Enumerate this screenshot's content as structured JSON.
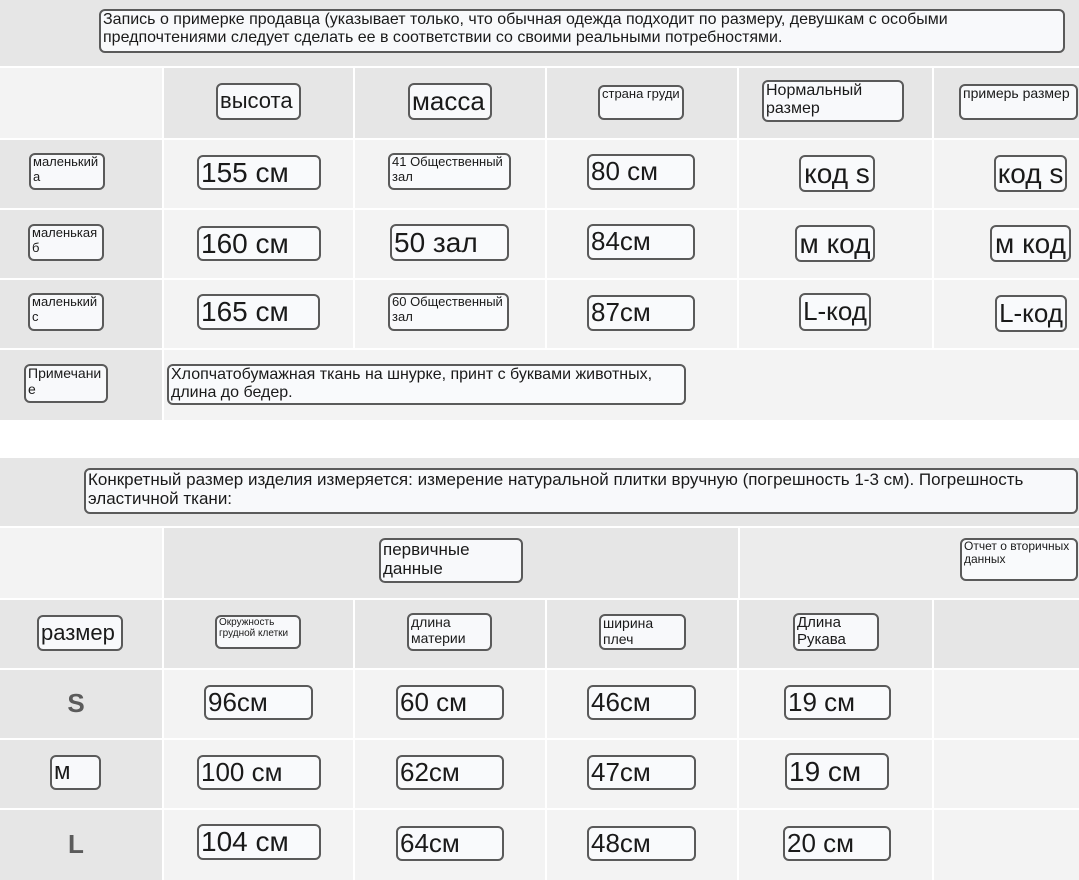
{
  "fitting": {
    "title": "Запись о примерке продавца (указывает только, что обычная одежда подходит по размеру, девушкам с особыми предпочтениями следует сделать ее в соответствии со своими реальными потребностями.",
    "headers": [
      "высота",
      "масса",
      "страна груди",
      "Нормальный размер",
      "примерь размер"
    ],
    "rows": [
      {
        "label": "маленький а",
        "height": "155 см",
        "weight": "41 Общественный зал",
        "chest": "80 см",
        "normal": "код s",
        "try": "код s"
      },
      {
        "label": "маленькая б",
        "height": "160 см",
        "weight": "50 зал",
        "chest": "84см",
        "normal": "м код",
        "try": "м код"
      },
      {
        "label": "маленький с",
        "height": "165 см",
        "weight": "60 Общественный зал",
        "chest": "87см",
        "normal": "L-код",
        "try": "L-код"
      }
    ],
    "note_label": "Примечание",
    "note_text": "Хлопчатобумажная ткань на шнурке, принт с буквами животных, длина до бедер."
  },
  "measure": {
    "title": "Конкретный размер изделия измеряется: измерение натуральной плитки вручную (погрешность 1-3 см). Погрешность эластичной ткани:",
    "primary_label": "первичные данные",
    "secondary_label": "Отчет о вторичных данных",
    "headers": [
      "размер",
      "Окружность грудной клетки",
      "длина материи",
      "ширина плеч",
      "Длина Рукава"
    ],
    "rows": [
      {
        "size": "S",
        "chest": "96см",
        "length": "60 см",
        "shoulder": "46см",
        "sleeve": "19 см"
      },
      {
        "size": "м",
        "chest": "100 см",
        "length": "62см",
        "shoulder": "47см",
        "sleeve": "19 см"
      },
      {
        "size": "L",
        "chest": "104 см",
        "length": "64см",
        "shoulder": "48см",
        "sleeve": "20 см"
      }
    ]
  }
}
